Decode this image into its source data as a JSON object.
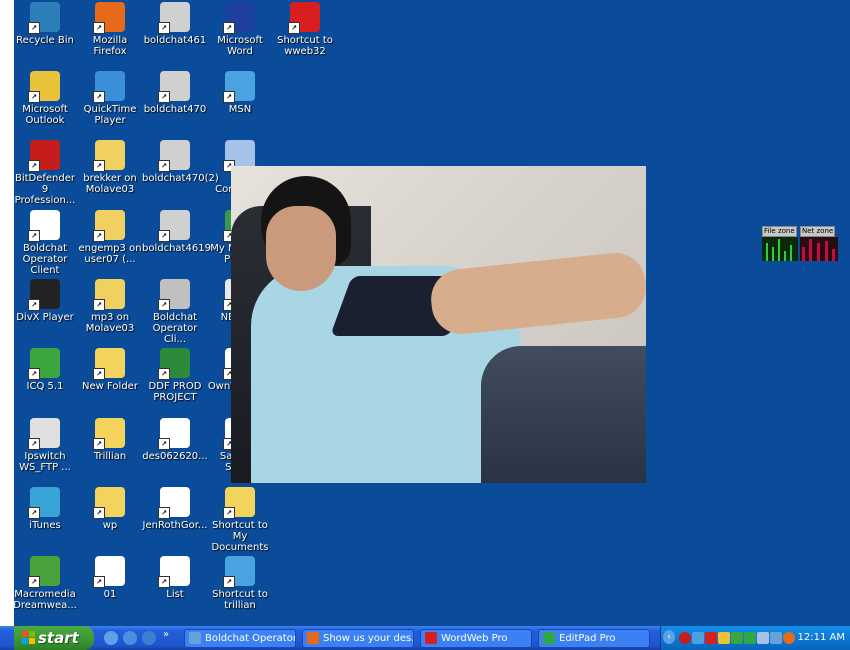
{
  "desktop": {
    "icons": [
      {
        "label": "Recycle Bin",
        "icon": "recycle-bin-icon",
        "color": "#2c7fb8",
        "col": 0,
        "row": 0
      },
      {
        "label": "Mozilla Firefox",
        "icon": "firefox-icon",
        "color": "#e66a1a",
        "col": 1,
        "row": 0
      },
      {
        "label": "boldchat461",
        "icon": "boldchat-icon",
        "color": "#d0d0d0",
        "col": 2,
        "row": 0
      },
      {
        "label": "Microsoft Word",
        "icon": "word-icon",
        "color": "#1e3f9e",
        "col": 3,
        "row": 0
      },
      {
        "label": "Shortcut to wweb32",
        "icon": "wordweb-icon",
        "color": "#d81e1e",
        "col": 4,
        "row": 0
      },
      {
        "label": "Microsoft Outlook",
        "icon": "outlook-icon",
        "color": "#e8c33a",
        "col": 0,
        "row": 1
      },
      {
        "label": "QuickTime Player",
        "icon": "quicktime-icon",
        "color": "#3a8fd8",
        "col": 1,
        "row": 1
      },
      {
        "label": "boldchat470",
        "icon": "boldchat-icon",
        "color": "#d0d0d0",
        "col": 2,
        "row": 1
      },
      {
        "label": "MSN",
        "icon": "msn-icon",
        "color": "#4aa3e0",
        "col": 3,
        "row": 1
      },
      {
        "label": "BitDefender 9 Profession...",
        "icon": "bitdefender-icon",
        "color": "#c51c1c",
        "col": 0,
        "row": 2
      },
      {
        "label": "brekker on Molave03",
        "icon": "network-drive-icon",
        "color": "#f0d060",
        "col": 1,
        "row": 2
      },
      {
        "label": "boldchat470(2)",
        "icon": "boldchat-icon",
        "color": "#d0d0d0",
        "col": 2,
        "row": 2
      },
      {
        "label": "My Computer",
        "icon": "my-computer-icon",
        "color": "#a6c2e6",
        "col": 3,
        "row": 2
      },
      {
        "label": "Boldchat Operator Client",
        "icon": "application-icon",
        "color": "#ffffff",
        "col": 0,
        "row": 3
      },
      {
        "label": "engemp3 on user07 (...",
        "icon": "network-drive-icon",
        "color": "#f0d060",
        "col": 1,
        "row": 3
      },
      {
        "label": "boldchat4619",
        "icon": "boldchat-icon",
        "color": "#d0d0d0",
        "col": 2,
        "row": 3
      },
      {
        "label": "My Network Places",
        "icon": "network-places-icon",
        "color": "#3a9a4a",
        "col": 3,
        "row": 3
      },
      {
        "label": "DivX Player",
        "icon": "divx-icon",
        "color": "#222222",
        "col": 0,
        "row": 4
      },
      {
        "label": "mp3 on Molave03",
        "icon": "network-drive-icon",
        "color": "#f0d060",
        "col": 1,
        "row": 4
      },
      {
        "label": "Boldchat Operator Cli...",
        "icon": "boldchat-icon",
        "color": "#c0c0c0",
        "col": 2,
        "row": 4
      },
      {
        "label": "NETSET",
        "icon": "netset-icon",
        "color": "#e8e8e8",
        "col": 3,
        "row": 4
      },
      {
        "label": "ICQ 5.1",
        "icon": "icq-icon",
        "color": "#3da53d",
        "col": 0,
        "row": 5
      },
      {
        "label": "New Folder",
        "icon": "folder-icon",
        "color": "#f3d35b",
        "col": 1,
        "row": 5
      },
      {
        "label": "DDF PROD PROJECT",
        "icon": "excel-icon",
        "color": "#2d8a3a",
        "col": 2,
        "row": 5
      },
      {
        "label": "OwnVersions",
        "icon": "word-doc-icon",
        "color": "#ffffff",
        "col": 3,
        "row": 5
      },
      {
        "label": "Ipswitch WS_FTP ...",
        "icon": "ftp-icon",
        "color": "#e0e0e0",
        "col": 0,
        "row": 6
      },
      {
        "label": "Trillian",
        "icon": "folder-icon",
        "color": "#f3d35b",
        "col": 1,
        "row": 6
      },
      {
        "label": "des062620...",
        "icon": "text-file-icon",
        "color": "#ffffff",
        "col": 2,
        "row": 6
      },
      {
        "label": "Sales-n-Stat...",
        "icon": "application-icon",
        "color": "#ffffff",
        "col": 3,
        "row": 6
      },
      {
        "label": "iTunes",
        "icon": "itunes-icon",
        "color": "#3aa3d8",
        "col": 0,
        "row": 7
      },
      {
        "label": "wp",
        "icon": "folder-icon",
        "color": "#f3d35b",
        "col": 1,
        "row": 7
      },
      {
        "label": "JenRothGor...",
        "icon": "pdf-icon",
        "color": "#ffffff",
        "col": 2,
        "row": 7
      },
      {
        "label": "Shortcut to My Documents",
        "icon": "my-documents-icon",
        "color": "#f3d35b",
        "col": 3,
        "row": 7
      },
      {
        "label": "Macromedia Dreamwea...",
        "icon": "dreamweaver-icon",
        "color": "#4aa33a",
        "col": 0,
        "row": 8
      },
      {
        "label": "01",
        "icon": "text-file-icon",
        "color": "#ffffff",
        "col": 1,
        "row": 8
      },
      {
        "label": "List",
        "icon": "word-doc-icon",
        "color": "#ffffff",
        "col": 2,
        "row": 8
      },
      {
        "label": "Shortcut to trillian",
        "icon": "trillian-icon",
        "color": "#4aa3e0",
        "col": 3,
        "row": 8
      }
    ]
  },
  "meter": {
    "file_zone_label": "File zone",
    "net_zone_label": "Net zone"
  },
  "taskbar": {
    "start_label": "start",
    "tasks": [
      {
        "label": "Boldchat Operator...",
        "icon": "boldchat-task-icon",
        "color": "#6aa0d8"
      },
      {
        "label": "Show us your des...",
        "icon": "firefox-task-icon",
        "color": "#e66a1a"
      },
      {
        "label": "WordWeb Pro",
        "icon": "wordweb-task-icon",
        "color": "#d81e1e"
      },
      {
        "label": "EditPad Pro",
        "icon": "editpad-task-icon",
        "color": "#2fa84a"
      }
    ],
    "clock": "12:11 AM"
  }
}
